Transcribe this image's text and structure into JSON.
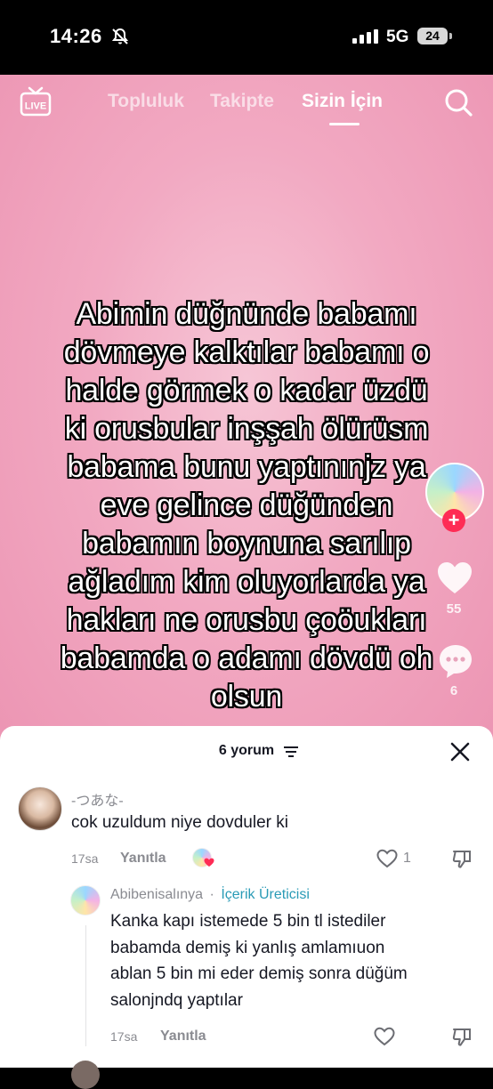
{
  "status_bar": {
    "time": "14:26",
    "network": "5G",
    "battery": "24",
    "icons": [
      "bell-slash-icon",
      "signal-bars-icon",
      "battery-icon"
    ]
  },
  "top_nav": {
    "tabs": [
      {
        "label": "Topluluk",
        "active": false
      },
      {
        "label": "Takipte",
        "active": false
      },
      {
        "label": "Sizin İçin",
        "active": true
      }
    ],
    "icons": [
      "live-icon",
      "search-icon"
    ]
  },
  "video": {
    "caption_lines": [
      "Abimin düğnünde babamı",
      "dövmeye kalktılar babamı o",
      "halde görmek o kadar üzdü",
      "ki orusbular inşşah ölürüsm",
      "babama bunu yaptınınjz ya",
      "eve gelince düğünden",
      "babamın boynuna sarılıp",
      "ağladım kim oluyorlarda ya",
      "hakları ne orusbu çoöukları",
      "babamda o adamı dövdü oh",
      "olsun"
    ],
    "like_count": "55",
    "comment_count": "6",
    "background_color": "#f2a9c2"
  },
  "comments_sheet": {
    "title": "6 yorum",
    "comments": [
      {
        "username": "-つあな-",
        "text": "cok uzuldum niye dovduler ki",
        "time": "17sa",
        "reply_label": "Yanıtla",
        "likes": "1"
      }
    ],
    "reply": {
      "username": "Abibenisalınya",
      "separator": "·",
      "badge": "İçerik Üreticisi",
      "text_lines": [
        "Kanka kapı istemede 5 bin tl istediler",
        "babamda demiş ki yanlış amlamıuon",
        "ablan 5 bin mi eder demiş sonra düğüm",
        "salonjndq yaptılar"
      ],
      "time": "17sa",
      "reply_label": "Yanıtla"
    },
    "accent_color": "#fe2c55",
    "badge_color": "#2a9bb6"
  }
}
